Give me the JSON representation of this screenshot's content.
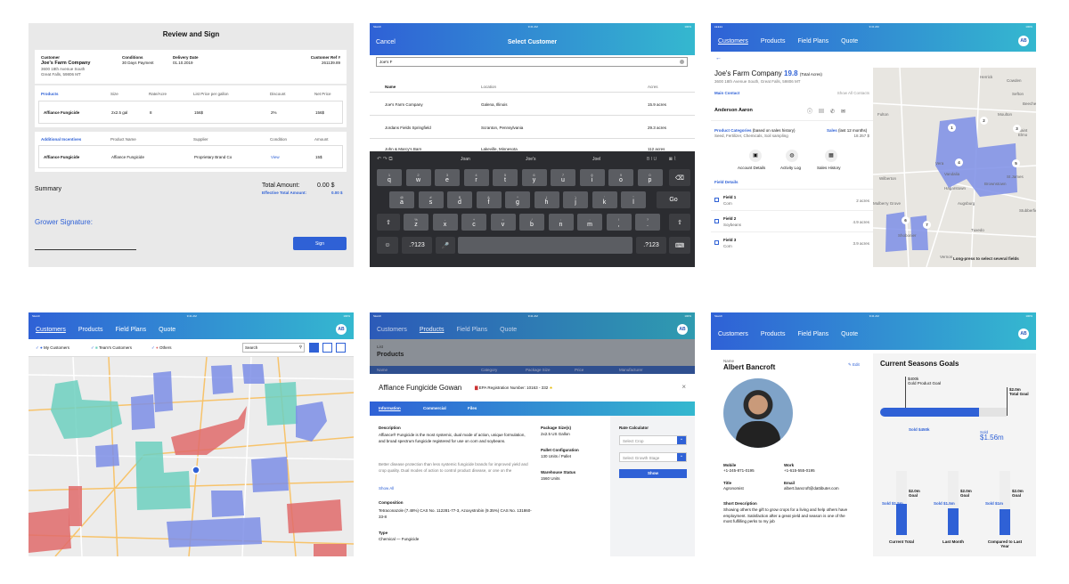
{
  "p1": {
    "title": "Review and Sign",
    "customer_label": "Customer",
    "customer_name": "Joe's Farm Company",
    "customer_addr1": "3600 18th Avenue South",
    "customer_addr2": "Great Falls, 59806 MT",
    "conditions_label": "Conditions",
    "conditions_value": "30 Days Payment",
    "delivery_label": "Delivery Date",
    "delivery_value": "01.10.2019",
    "ref_label": "Customer Ref #",
    "ref_value": "261139.89",
    "products_label": "Products",
    "products_headers": [
      "Size",
      "Rate/Acre",
      "List Price per gallon",
      "Discount",
      "Net Price"
    ],
    "product_row": [
      "Affiance Fungicide",
      "2x2.5 gal",
      "8",
      "156$",
      "2%",
      "156$"
    ],
    "addl_label": "Additional Incentives",
    "addl_headers": [
      "Product Name",
      "Supplier",
      "Condition",
      "Amount"
    ],
    "addl_row": [
      "Affiance Fungicide",
      "Affiance Fungicide",
      "Proprietary Brand Co",
      "View",
      "15$"
    ],
    "summary": "Summary",
    "total_label": "Total Amount:",
    "total_value": "0.00 $",
    "eff_label": "Effective Total Amount:",
    "eff_value": "0.00 $",
    "grower_sig": "Grower Signature:",
    "sign_button": "Sign"
  },
  "p2": {
    "status_left": "Sketch",
    "status_time": "9:41 AM",
    "status_right": "100%",
    "cancel": "Cancel",
    "title": "Select Customer",
    "search_value": "Joe's F",
    "headers": [
      "Name",
      "Location",
      "Acres"
    ],
    "rows": [
      {
        "name": "Joe's Farm Company",
        "loc": "Galena, Illinois",
        "acres": "15.9 acres"
      },
      {
        "name": "Jordans Fields Springfield",
        "loc": "Scranton, Pennsylvania",
        "acres": "29.3 acres"
      },
      {
        "name": "John & Marcy's Barn",
        "loc": "Lakeville, Minnesota",
        "acres": "112 acres"
      }
    ],
    "suggestions": [
      "Joan",
      "Joe's",
      "Joel"
    ],
    "biu": "B I U",
    "row1": [
      [
        "1",
        "q"
      ],
      [
        "2",
        "w"
      ],
      [
        "3",
        "e"
      ],
      [
        "4",
        "r"
      ],
      [
        "5",
        "t"
      ],
      [
        "6",
        "y"
      ],
      [
        "7",
        "u"
      ],
      [
        "8",
        "i"
      ],
      [
        "9",
        "o"
      ],
      [
        "0",
        "p"
      ]
    ],
    "row2": [
      [
        "@",
        "a"
      ],
      [
        "#",
        "s"
      ],
      [
        "$",
        "d"
      ],
      [
        "&",
        "f"
      ],
      [
        "*",
        "g"
      ],
      [
        "(",
        "h"
      ],
      [
        ")",
        "j"
      ],
      [
        "'",
        "k"
      ],
      [
        "\"",
        "l"
      ]
    ],
    "row3": [
      [
        "%",
        "z"
      ],
      [
        "-",
        "x"
      ],
      [
        "+",
        "c"
      ],
      [
        "=",
        "v"
      ],
      [
        "/",
        "b"
      ],
      [
        ";",
        "n"
      ],
      [
        ":",
        "m"
      ],
      [
        "!",
        ","
      ],
      [
        "?",
        "."
      ]
    ],
    "go": "Go",
    "num_key": ".?123"
  },
  "p3": {
    "nav": [
      "Customers",
      "Products",
      "Field Plans",
      "Quote"
    ],
    "avatar": "AB",
    "customer": "Joe's Farm Company",
    "acres": "19.8",
    "acres_label": "(Total Acres)",
    "address": "3600 18th Avenue South, Great Falls, 59806 MT",
    "main_contact": "Main Contact",
    "show_all": "Show All Contacts",
    "contact_name": "Anderson Aaron",
    "product_cat": "Product Categories",
    "product_cat_note": "(based on sales history)",
    "product_cat_value": "Seed, Fertilizer, Chemicals, Soil sampling",
    "sales": "Sales",
    "sales_note": "(last 12 months)",
    "sales_value": "18.357 $",
    "actions": [
      "Account Details",
      "Activity Log",
      "Sales History"
    ],
    "field_details": "Field Details",
    "fields": [
      {
        "name": "Field 1",
        "crop": "Corn",
        "acres": "2 acres"
      },
      {
        "name": "Field 2",
        "crop": "Soybeans",
        "acres": "4.9 acres"
      },
      {
        "name": "Field 3",
        "crop": "Corn",
        "acres": "3.9 acres"
      }
    ],
    "map_labels": [
      "Herrick",
      "Cowden",
      "Beecher",
      "Moulton",
      "Fulton",
      "Vera",
      "Vandalia",
      "St James",
      "Hagarstown",
      "Brownstown",
      "Augsburg",
      "Mulberry Grove",
      "Vernon",
      "Tuxedo",
      "Saint Elmo",
      "Shobonier",
      "Stubberfield",
      "Wilberton",
      "Sefton"
    ],
    "map_pins": [
      "1",
      "2",
      "3",
      "4",
      "5",
      "6",
      "7"
    ],
    "hint": "Long-press to select several fields"
  },
  "p4": {
    "status_left": "Sketch",
    "status_time": "9:41 AM",
    "status_right": "100%",
    "nav": [
      "Customers",
      "Products",
      "Field Plans",
      "Quote"
    ],
    "avatar": "AB",
    "filters": [
      "My Customers",
      "Team's Customers",
      "Others"
    ],
    "search_placeholder": "Search",
    "colors": {
      "mine": "#6f86e0",
      "team": "#6dd0bf",
      "others": "#e06b6b"
    }
  },
  "p5": {
    "status_left": "Sketch",
    "status_time": "9:41 AM",
    "status_right": "100%",
    "nav": [
      "Customers",
      "Products",
      "Field Plans",
      "Quote"
    ],
    "avatar": "AB",
    "list": "List",
    "products": "Products",
    "col_heads": [
      "Name",
      "Category",
      "Package Size",
      "Price",
      "Manufacturer"
    ],
    "product_title": "Affiance Fungicide Gowan",
    "epa": "EPA Registration Number: 10163 - 332",
    "tabs": [
      "Information",
      "Commercial",
      "Files"
    ],
    "desc_label": "Description",
    "desc_text": "Affiance® Fungicide is the most systemic, dual mode of action, unique formulation, and broad spectrum fungicide registered for use on corn and soybeans.",
    "desc_text2": "Better disease protection than less systemic fungicide brands for improved yield and crop quality. Dual modes of action to control product disease, or one on the development of disease",
    "show_all": "Show All",
    "composition_label": "Composition",
    "composition": "Tetraconazole (7.48%) CAS No. 112281-77-3, Azoxystrobin (9.35%) CAS No. 131860-33-8",
    "type_label": "Type",
    "type_value": "Chemical — Fungicide",
    "package_label": "Package Size(s)",
    "package_value": "2x2.5 US Gallon",
    "pallet_label": "Pallet Configuration",
    "pallet_value": "130 Units / Pallet",
    "warehouse_label": "Warehouse Status",
    "warehouse_value": "1560 Units",
    "rate_label": "Rate Calculator",
    "crop_placeholder": "Select Crop",
    "growth_placeholder": "Select Growth Stage",
    "show_button": "Show"
  },
  "p6": {
    "nav": [
      "Customers",
      "Products",
      "Field Plans",
      "Quote"
    ],
    "avatar": "AB",
    "status_left": "Sketch",
    "status_time": "9:41 AM",
    "status_right": "100%",
    "name_label": "Name",
    "name": "Albert Bancroft",
    "edit": "Edit",
    "mobile_label": "Mobile",
    "mobile": "+1-245-871-0195",
    "work_label": "Work",
    "work": "+1-615-555-0195",
    "title_label": "Title",
    "title_value": "Agronomist",
    "email_label": "Email",
    "email": "albert.bancroft@dattibuter.com",
    "short_label": "Short Description",
    "short_text": "Showing others the gift to grow crops for a living and help others have employment. Satisfaction after a great yield and season is one of the most fulfilling perks to my job",
    "goals_title": "Current Seasons Goals",
    "product_goal_amt": "$400k",
    "product_goal_lbl": "Gold Product Goal",
    "total_goal_amt": "$2.0m",
    "total_goal_lbl": "Total Goal",
    "sold_small": "Sold $450k",
    "sold_big_lbl": "Sold",
    "sold_big": "$1.56m",
    "progress_fraction": 0.78,
    "cols": [
      {
        "label": "Current Total",
        "goal": "$2.0m",
        "goal_lbl": "Goal",
        "sold": "Sold $1.5m",
        "fill": 0.48
      },
      {
        "label": "Last Month",
        "goal": "$2.0m",
        "goal_lbl": "Goal",
        "sold": "Sold $1.5m",
        "fill": 0.42
      },
      {
        "label": "Compared to Last Year",
        "goal": "$2.0m",
        "goal_lbl": "Goal",
        "sold": "Sold $1m",
        "fill": 0.4
      }
    ]
  }
}
